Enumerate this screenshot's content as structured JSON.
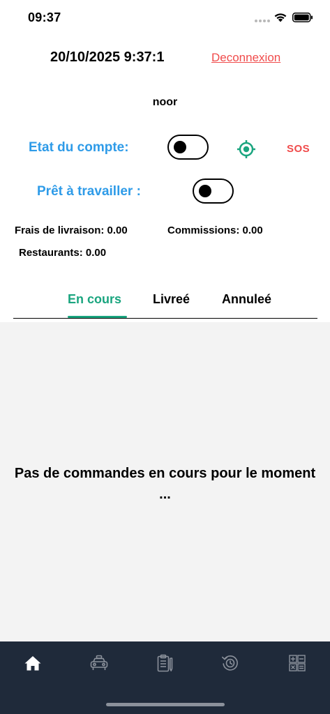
{
  "status_bar": {
    "time": "09:37"
  },
  "header": {
    "datetime": "20/10/2025 9:37:1",
    "logout_label": "Deconnexion"
  },
  "user": {
    "name": "noor"
  },
  "account_state": {
    "label": "Etat du compte:",
    "enabled": false
  },
  "ready_to_work": {
    "label": "Prêt à travailler :",
    "enabled": false
  },
  "sos_label": "SOS",
  "stats": {
    "delivery_fees": "Frais de livraison: 0.00",
    "commissions": "Commissions: 0.00",
    "restaurants": "Restaurants: 0.00"
  },
  "tabs": [
    {
      "label": "En cours",
      "active": true
    },
    {
      "label": "Livreé",
      "active": false
    },
    {
      "label": "Annuleé",
      "active": false
    }
  ],
  "empty_state": {
    "line1": "Pas de commandes en cours pour le moment",
    "line2": "..."
  },
  "bottom_nav": [
    {
      "icon": "home-icon",
      "active": true
    },
    {
      "icon": "taxi-icon",
      "active": false
    },
    {
      "icon": "clipboard-icon",
      "active": false
    },
    {
      "icon": "history-icon",
      "active": false
    },
    {
      "icon": "calculator-icon",
      "active": false
    }
  ],
  "colors": {
    "accent_blue": "#2e9be8",
    "accent_green": "#1aa57f",
    "danger_red": "#f04b4b",
    "nav_bg": "#1f2a3a",
    "content_bg": "#f3f3f3"
  }
}
